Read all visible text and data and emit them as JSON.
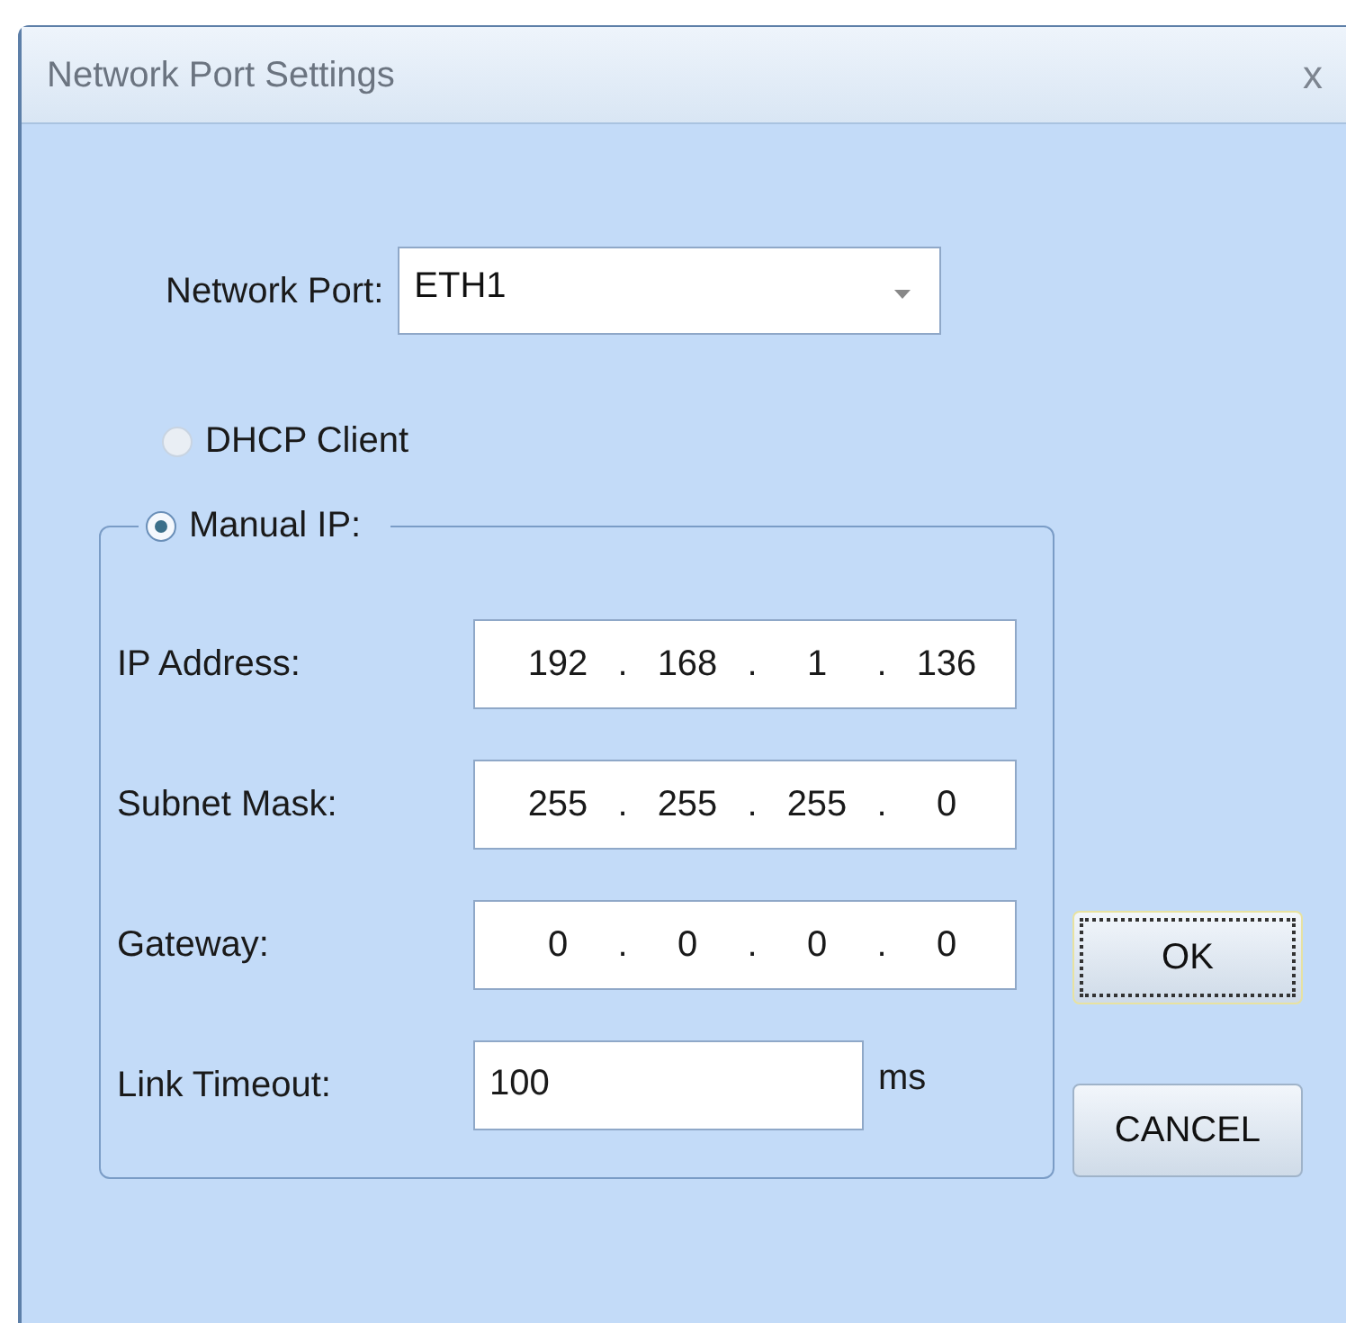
{
  "window": {
    "title": "Network Port Settings",
    "close": "x"
  },
  "network_port": {
    "label": "Network Port:",
    "value": "ETH1"
  },
  "modes": [
    {
      "label": "DHCP Client",
      "selected": false
    },
    {
      "label": "Manual IP:",
      "selected": true
    }
  ],
  "fields": [
    {
      "kind": "ip",
      "label": "IP Address:",
      "octets": [
        "192",
        "168",
        "1",
        "136"
      ],
      "separator": "."
    },
    {
      "kind": "ip",
      "label": "Subnet Mask:",
      "octets": [
        "255",
        "255",
        "255",
        "0"
      ],
      "separator": "."
    },
    {
      "kind": "ip",
      "label": "Gateway:",
      "octets": [
        "0",
        "0",
        "0",
        "0"
      ],
      "separator": "."
    },
    {
      "kind": "text",
      "label": "Link Timeout:",
      "value": "100",
      "unit": "ms"
    }
  ],
  "buttons": [
    {
      "label": "OK",
      "focused": true
    },
    {
      "label": "CANCEL",
      "focused": false
    }
  ]
}
